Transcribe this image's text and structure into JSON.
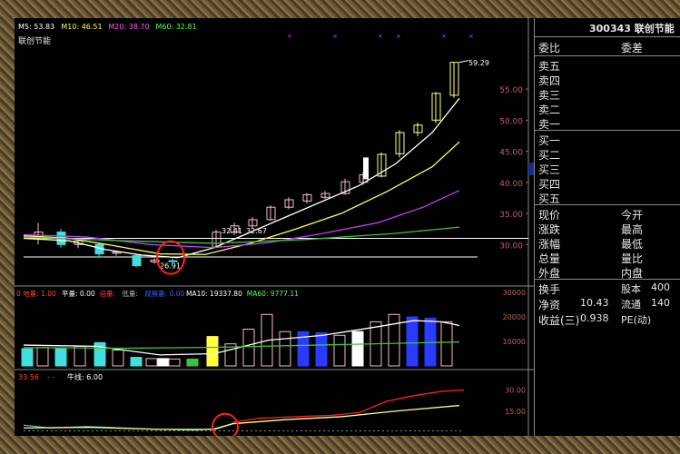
{
  "header": {
    "ma_labels": [
      {
        "text": "M5: 53.83",
        "color": "#ffffff"
      },
      {
        "text": "M10: 46.51",
        "color": "#ffff55"
      },
      {
        "text": "M20: 38.70",
        "color": "#ff55ff"
      },
      {
        "text": "M60: 32.81",
        "color": "#55ff55"
      }
    ],
    "stock_name": "联创节能"
  },
  "price_axis": [
    "55.00",
    "50.00",
    "45.00",
    "40.00",
    "35.00",
    "30.00"
  ],
  "price_axis_highlight": "42.17",
  "annotations": {
    "high": "59.29",
    "low": "26.91",
    "mid_left": "32.41",
    "mid_right": "32.67"
  },
  "volume_header": [
    {
      "text": "0 地量: 1.00",
      "color": "#ff4040"
    },
    {
      "text": "平量: 0.00",
      "color": "#ffffff"
    },
    {
      "text": "倍量: ",
      "color": "#ff4040"
    },
    {
      "text": "低量: ",
      "color": "#b0b0b0"
    },
    {
      "text": "观察量: 0.00",
      "color": "#3a5cff"
    },
    {
      "text": "MA10: 19337.80",
      "color": "#ffffff"
    },
    {
      "text": "MA60: 9777.11",
      "color": "#55ff55"
    }
  ],
  "volume_axis": [
    "30000",
    "20000",
    "10000"
  ],
  "indicator_header": [
    {
      "text": "33.56",
      "color": "#ff4040"
    },
    {
      "text": "牛线: 6.00",
      "color": "#ffffff"
    }
  ],
  "indicator_axis": [
    "30.00",
    "15.00"
  ],
  "quote_panel": {
    "code_name": "300343 联创节能",
    "ratio_label": "委比",
    "diff_label": "委差",
    "sell_rows": [
      "卖五",
      "卖四",
      "卖三",
      "卖二",
      "卖一"
    ],
    "buy_rows": [
      "买一",
      "买二",
      "买三",
      "买四",
      "买五"
    ],
    "stats_left": [
      "现价",
      "涨跌",
      "涨幅",
      "总量",
      "外盘"
    ],
    "stats_right": [
      "今开",
      "最高",
      "最低",
      "量比",
      "内盘"
    ],
    "bottom_rows": [
      {
        "label": "换手",
        "value": "",
        "label2": "股本",
        "value2": "400"
      },
      {
        "label": "净资",
        "value": "10.43",
        "label2": "流通",
        "value2": "140"
      },
      {
        "label": "收益(三)",
        "value": "0.938",
        "label2": "PE(动)",
        "value2": ""
      }
    ]
  },
  "colors": {
    "up": "#ffffff",
    "down": "#40e0e0",
    "ma5": "#ffffff",
    "ma10": "#ffff55",
    "ma20": "#c040ff",
    "ma60": "#40c040",
    "circle": "#ff2020"
  }
}
